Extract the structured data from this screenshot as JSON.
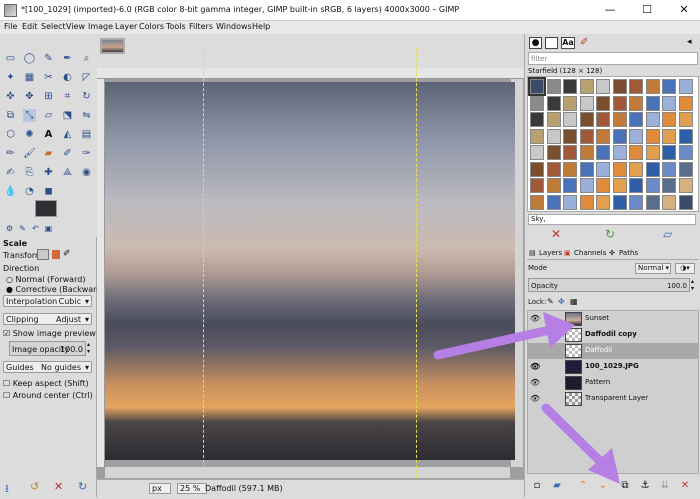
{
  "window": {
    "title": "*[100_1029] (imported)-6.0 (RGB color 8-bit gamma integer, GIMP built-in sRGB, 6 layers) 4000x3000 – GIMP",
    "minimize": "—",
    "maximize": "☐",
    "close": "✕"
  },
  "menu": [
    "File",
    "Edit",
    "Select",
    "View",
    "Image",
    "Layer",
    "Colors",
    "Tools",
    "Filters",
    "Windows",
    "Help"
  ],
  "tool_options": {
    "title": "Scale",
    "transform_label": "Transform:",
    "direction_label": "Direction",
    "direction_opts": [
      "Normal (Forward)",
      "Corrective (Backward)"
    ],
    "interpolation_label": "Interpolation",
    "interpolation_value": "Cubic",
    "clipping_label": "Clipping",
    "clipping_value": "Adjust",
    "show_preview": "Show image preview",
    "opacity_label": "Image opacity",
    "opacity_value": "100.0",
    "guides_label": "Guides",
    "guides_value": "No guides",
    "keep_aspect": "Keep aspect (Shift)",
    "around_center": "Around center (Ctrl)"
  },
  "status": {
    "unit": "px",
    "zoom": "25 %",
    "layer_info": "Daffodil (597.1 MB)"
  },
  "patterns": {
    "filter_placeholder": "filter",
    "title": "Starfield (128 × 128)",
    "tag": "Sky,"
  },
  "layers_panel": {
    "tabs": [
      "Layers",
      "Channels",
      "Paths"
    ],
    "mode_label": "Mode",
    "mode_value": "Normal",
    "opacity_label": "Opacity",
    "opacity_value": "100.0",
    "lock_label": "Lock:",
    "layers": [
      {
        "name": "Sunset",
        "bold": false
      },
      {
        "name": "Daffodil copy",
        "bold": true
      },
      {
        "name": "Daffodil",
        "bold": false
      },
      {
        "name": "100_1029.JPG",
        "bold": true
      },
      {
        "name": "Pattern",
        "bold": false
      },
      {
        "name": "Transparent Layer",
        "bold": false
      }
    ]
  },
  "colors": {
    "accent": "#b67fe6",
    "selection": "#a9a9a9"
  }
}
